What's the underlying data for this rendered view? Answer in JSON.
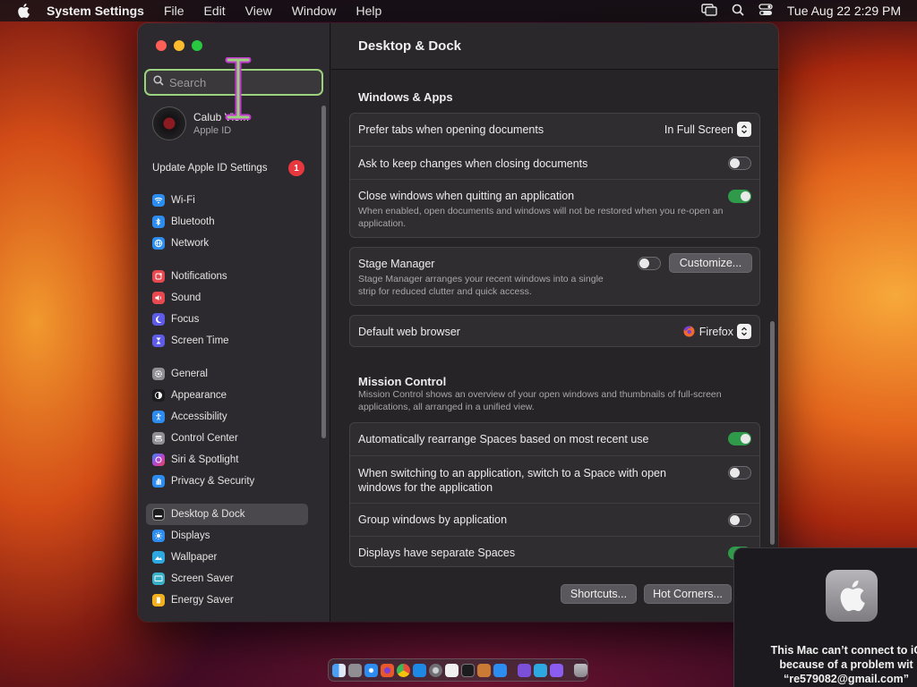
{
  "menubar": {
    "app_name": "System Settings",
    "menus": [
      "File",
      "Edit",
      "View",
      "Window",
      "Help"
    ],
    "clock": "Tue Aug 22  2:29 PM"
  },
  "sidebar": {
    "search_placeholder": "Search",
    "account": {
      "name": "Calub Viem",
      "subtitle": "Apple ID"
    },
    "update": {
      "label": "Update Apple ID Settings",
      "badge": "1"
    },
    "items": [
      {
        "label": "Wi-Fi",
        "icon": "wifi-icon",
        "color": "#2d8cf0"
      },
      {
        "label": "Bluetooth",
        "icon": "bluetooth-icon",
        "color": "#2d8cf0"
      },
      {
        "label": "Network",
        "icon": "globe-icon",
        "color": "#2d8cf0"
      },
      {
        "label": "Notifications",
        "icon": "bell-icon",
        "color": "#e8484f"
      },
      {
        "label": "Sound",
        "icon": "speaker-icon",
        "color": "#e8484f"
      },
      {
        "label": "Focus",
        "icon": "moon-icon",
        "color": "#5e5ce6"
      },
      {
        "label": "Screen Time",
        "icon": "hourglass-icon",
        "color": "#5e5ce6"
      },
      {
        "label": "General",
        "icon": "gear-icon",
        "color": "#8e8e93"
      },
      {
        "label": "Appearance",
        "icon": "appearance-icon",
        "color": "#1c1c1e"
      },
      {
        "label": "Accessibility",
        "icon": "accessibility-icon",
        "color": "#2d8cf0"
      },
      {
        "label": "Control Center",
        "icon": "switches-icon",
        "color": "#8e8e93"
      },
      {
        "label": "Siri & Spotlight",
        "icon": "siri-icon",
        "color": "#b444d8"
      },
      {
        "label": "Privacy & Security",
        "icon": "hand-icon",
        "color": "#2d8cf0"
      },
      {
        "label": "Desktop & Dock",
        "icon": "dock-icon",
        "color": "#1c1c1e"
      },
      {
        "label": "Displays",
        "icon": "sun-icon",
        "color": "#2d8cf0"
      },
      {
        "label": "Wallpaper",
        "icon": "wallpaper-icon",
        "color": "#2da8e0"
      },
      {
        "label": "Screen Saver",
        "icon": "screensaver-icon",
        "color": "#39b0c8"
      },
      {
        "label": "Energy Saver",
        "icon": "battery-icon",
        "color": "#f2b01e"
      }
    ]
  },
  "content": {
    "title": "Desktop & Dock",
    "windows_apps": {
      "heading": "Windows & Apps",
      "prefer_tabs": {
        "label": "Prefer tabs when opening documents",
        "value": "In Full Screen"
      },
      "ask_keep": {
        "label": "Ask to keep changes when closing documents",
        "on": false
      },
      "close_windows": {
        "label": "Close windows when quitting an application",
        "desc": "When enabled, open documents and windows will not be restored when you re-open an application.",
        "on": true
      },
      "stage_manager": {
        "label": "Stage Manager",
        "desc": "Stage Manager arranges your recent windows into a single strip for reduced clutter and quick access.",
        "on": false,
        "button": "Customize..."
      },
      "browser": {
        "label": "Default web browser",
        "value": "Firefox"
      }
    },
    "mission_control": {
      "heading": "Mission Control",
      "desc": "Mission Control shows an overview of your open windows and thumbnails of full-screen applications, all arranged in a unified view.",
      "auto_rearrange": {
        "label": "Automatically rearrange Spaces based on most recent use",
        "on": true
      },
      "switch_space": {
        "label": "When switching to an application, switch to a Space with open windows for the application",
        "on": false
      },
      "group_windows": {
        "label": "Group windows by application",
        "on": false
      },
      "separate_spaces": {
        "label": "Displays have separate Spaces",
        "on": true
      }
    },
    "buttons": {
      "shortcuts": "Shortcuts...",
      "hot_corners": "Hot Corners..."
    }
  },
  "notification": {
    "line1": "This Mac can’t connect to iC",
    "line2": "because of a problem wit",
    "line3": "“re579082@gmail.com”"
  },
  "dock": {
    "apps": [
      {
        "icon": "finder-icon",
        "color": "#4a9ff5"
      },
      {
        "icon": "launchpad-icon",
        "color": "#8e8e93"
      },
      {
        "icon": "safari-icon",
        "color": "#2d8cf0"
      },
      {
        "icon": "firefox-icon",
        "color": "#e8582a"
      },
      {
        "icon": "chrome-icon",
        "color": "#3cba54"
      },
      {
        "icon": "appstore-icon",
        "color": "#1e88e5"
      },
      {
        "icon": "settings-icon",
        "color": "#8e8e93"
      },
      {
        "icon": "textedit-icon",
        "color": "#f0f0f0"
      },
      {
        "icon": "terminal-icon",
        "color": "#1c1c1e"
      },
      {
        "icon": "script-icon",
        "color": "#c97b35"
      },
      {
        "icon": "vscode-icon",
        "color": "#2d8cf0"
      },
      {
        "icon": "visualstudio-icon",
        "color": "#7b4fd8"
      },
      {
        "icon": "cloud-icon",
        "color": "#2da8e0"
      },
      {
        "icon": "app-icon",
        "color": "#8a5cf0"
      },
      {
        "icon": "trash-icon",
        "color": "#9a989c"
      }
    ]
  }
}
